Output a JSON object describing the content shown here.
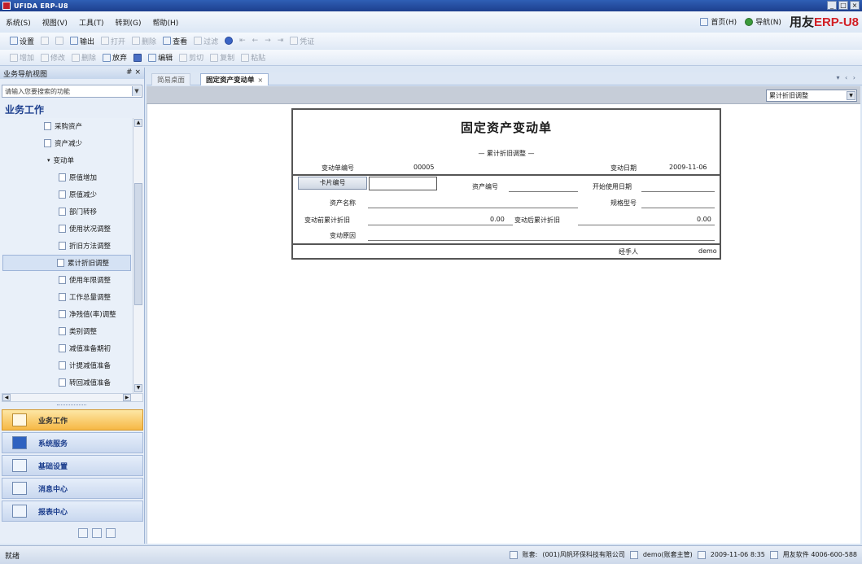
{
  "window": {
    "title": "UFIDA ERP-U8"
  },
  "menu": {
    "items": [
      "系统(S)",
      "视图(V)",
      "工具(T)",
      "转到(G)",
      "帮助(H)"
    ]
  },
  "header_right": {
    "home": "首页(H)",
    "guide": "导航(N)",
    "brand_prefix": "用友",
    "brand_erp": "ERP-",
    "brand_suffix": "U8"
  },
  "toolbar1": {
    "items": [
      {
        "label": "设置",
        "enabled": true
      },
      {
        "label": "",
        "enabled": false
      },
      {
        "label": "",
        "enabled": false
      },
      {
        "label": "输出",
        "enabled": true
      },
      {
        "label": "打开",
        "enabled": false
      },
      {
        "label": "删除",
        "enabled": false
      },
      {
        "label": "查看",
        "enabled": true
      },
      {
        "label": "过滤",
        "enabled": false
      },
      {
        "label": "",
        "enabled": true
      },
      {
        "label": "",
        "enabled": false
      },
      {
        "label": "",
        "enabled": false
      },
      {
        "label": "",
        "enabled": false
      },
      {
        "label": "",
        "enabled": false
      },
      {
        "label": "凭证",
        "enabled": false
      }
    ]
  },
  "toolbar2": {
    "items": [
      {
        "label": "增加",
        "enabled": false
      },
      {
        "label": "修改",
        "enabled": false
      },
      {
        "label": "删除",
        "enabled": false
      },
      {
        "label": "放弃",
        "enabled": true
      },
      {
        "label": "",
        "enabled": true
      },
      {
        "label": "编辑",
        "enabled": true
      },
      {
        "label": "剪切",
        "enabled": false
      },
      {
        "label": "复制",
        "enabled": false
      },
      {
        "label": "粘贴",
        "enabled": false
      }
    ]
  },
  "nav": {
    "title": "业务导航视图",
    "pin": "# ×",
    "search_placeholder": "请输入您要搜索的功能",
    "section": "业务工作",
    "tree": [
      {
        "label": "采购资产",
        "indent": 1
      },
      {
        "label": "资产减少",
        "indent": 1
      },
      {
        "label": "变动单",
        "indent": 1,
        "expanded": true
      },
      {
        "label": "原值增加",
        "indent": 2
      },
      {
        "label": "原值减少",
        "indent": 2
      },
      {
        "label": "部门转移",
        "indent": 2
      },
      {
        "label": "使用状况调整",
        "indent": 2
      },
      {
        "label": "折旧方法调整",
        "indent": 2
      },
      {
        "label": "累计折旧调整",
        "indent": 2,
        "selected": true
      },
      {
        "label": "使用年限调整",
        "indent": 2
      },
      {
        "label": "工作总量调整",
        "indent": 2
      },
      {
        "label": "净残值(率)调整",
        "indent": 2
      },
      {
        "label": "类别调整",
        "indent": 2
      },
      {
        "label": "减值准备期初",
        "indent": 2
      },
      {
        "label": "计提减值准备",
        "indent": 2
      },
      {
        "label": "转回减值准备",
        "indent": 2
      }
    ],
    "modules": [
      {
        "label": "业务工作",
        "active": true
      },
      {
        "label": "系统服务",
        "active": false
      },
      {
        "label": "基础设置",
        "active": false
      },
      {
        "label": "消息中心",
        "active": false
      },
      {
        "label": "报表中心",
        "active": false
      }
    ]
  },
  "tabs": {
    "inactive": "简易桌面",
    "active": "固定资产变动单",
    "nav_arrows": "▾ ‹ ›"
  },
  "voucher_select": "累计折旧调整",
  "form": {
    "title": "固定资产变动单",
    "subtitle": "— 累计折旧调整 —",
    "doc_no_label": "变动单编号",
    "doc_no": "00005",
    "date_label": "变动日期",
    "date": "2009-11-06",
    "card_btn": "卡片编号",
    "asset_no_label": "资产编号",
    "start_date_label": "开始使用日期",
    "asset_name_label": "资产名称",
    "spec_label": "规格型号",
    "before_label": "变动前累计折旧",
    "before_value": "0.00",
    "after_label": "变动后累计折旧",
    "after_value": "0.00",
    "reason_label": "变动原因",
    "handler_label": "经手人",
    "handler": "demo"
  },
  "status": {
    "ready": "就绪",
    "account_label": "账套:",
    "account": "(001)风帆环保科技有限公司",
    "user": "demo(账套主管)",
    "datetime": "2009-11-06 8:35",
    "support": "用友软件 4006-600-588"
  }
}
